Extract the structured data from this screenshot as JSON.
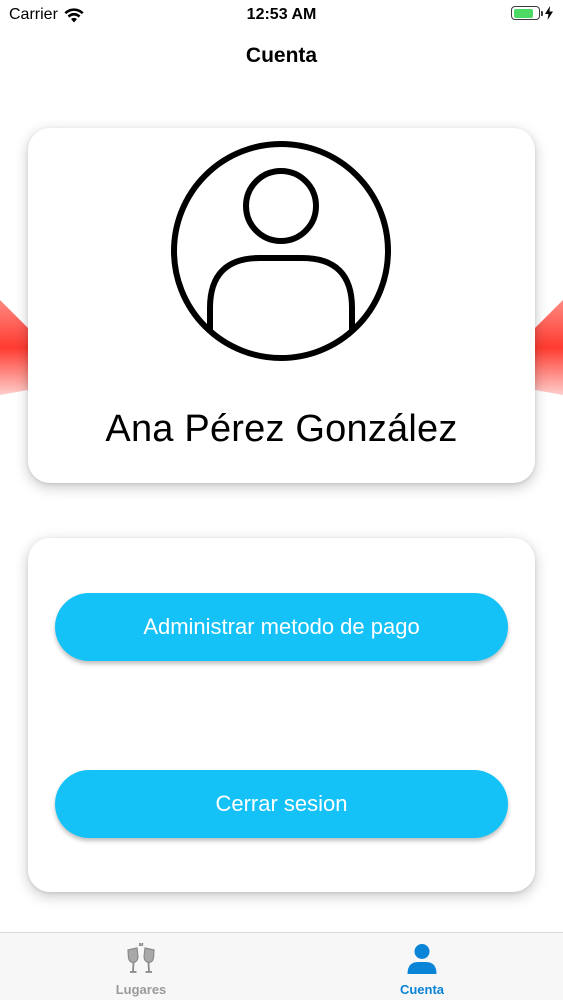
{
  "status_bar": {
    "carrier": "Carrier",
    "time": "12:53 AM",
    "battery_level": 0.8
  },
  "nav": {
    "title": "Cuenta"
  },
  "profile": {
    "name": "Ana Pérez González",
    "avatar_icon": "user-circle-icon"
  },
  "actions": {
    "payment_label": "Administrar metodo de pago",
    "logout_label": "Cerrar sesion"
  },
  "tabs": [
    {
      "label": "Lugares",
      "icon": "toast-glasses-icon",
      "active": false
    },
    {
      "label": "Cuenta",
      "icon": "person-icon",
      "active": true
    }
  ],
  "colors": {
    "accent": "#15c2f7",
    "tab_active": "#0a84d6",
    "tab_inactive": "#9a9a9a",
    "decor": "#ff3b30",
    "battery": "#4cd964"
  }
}
